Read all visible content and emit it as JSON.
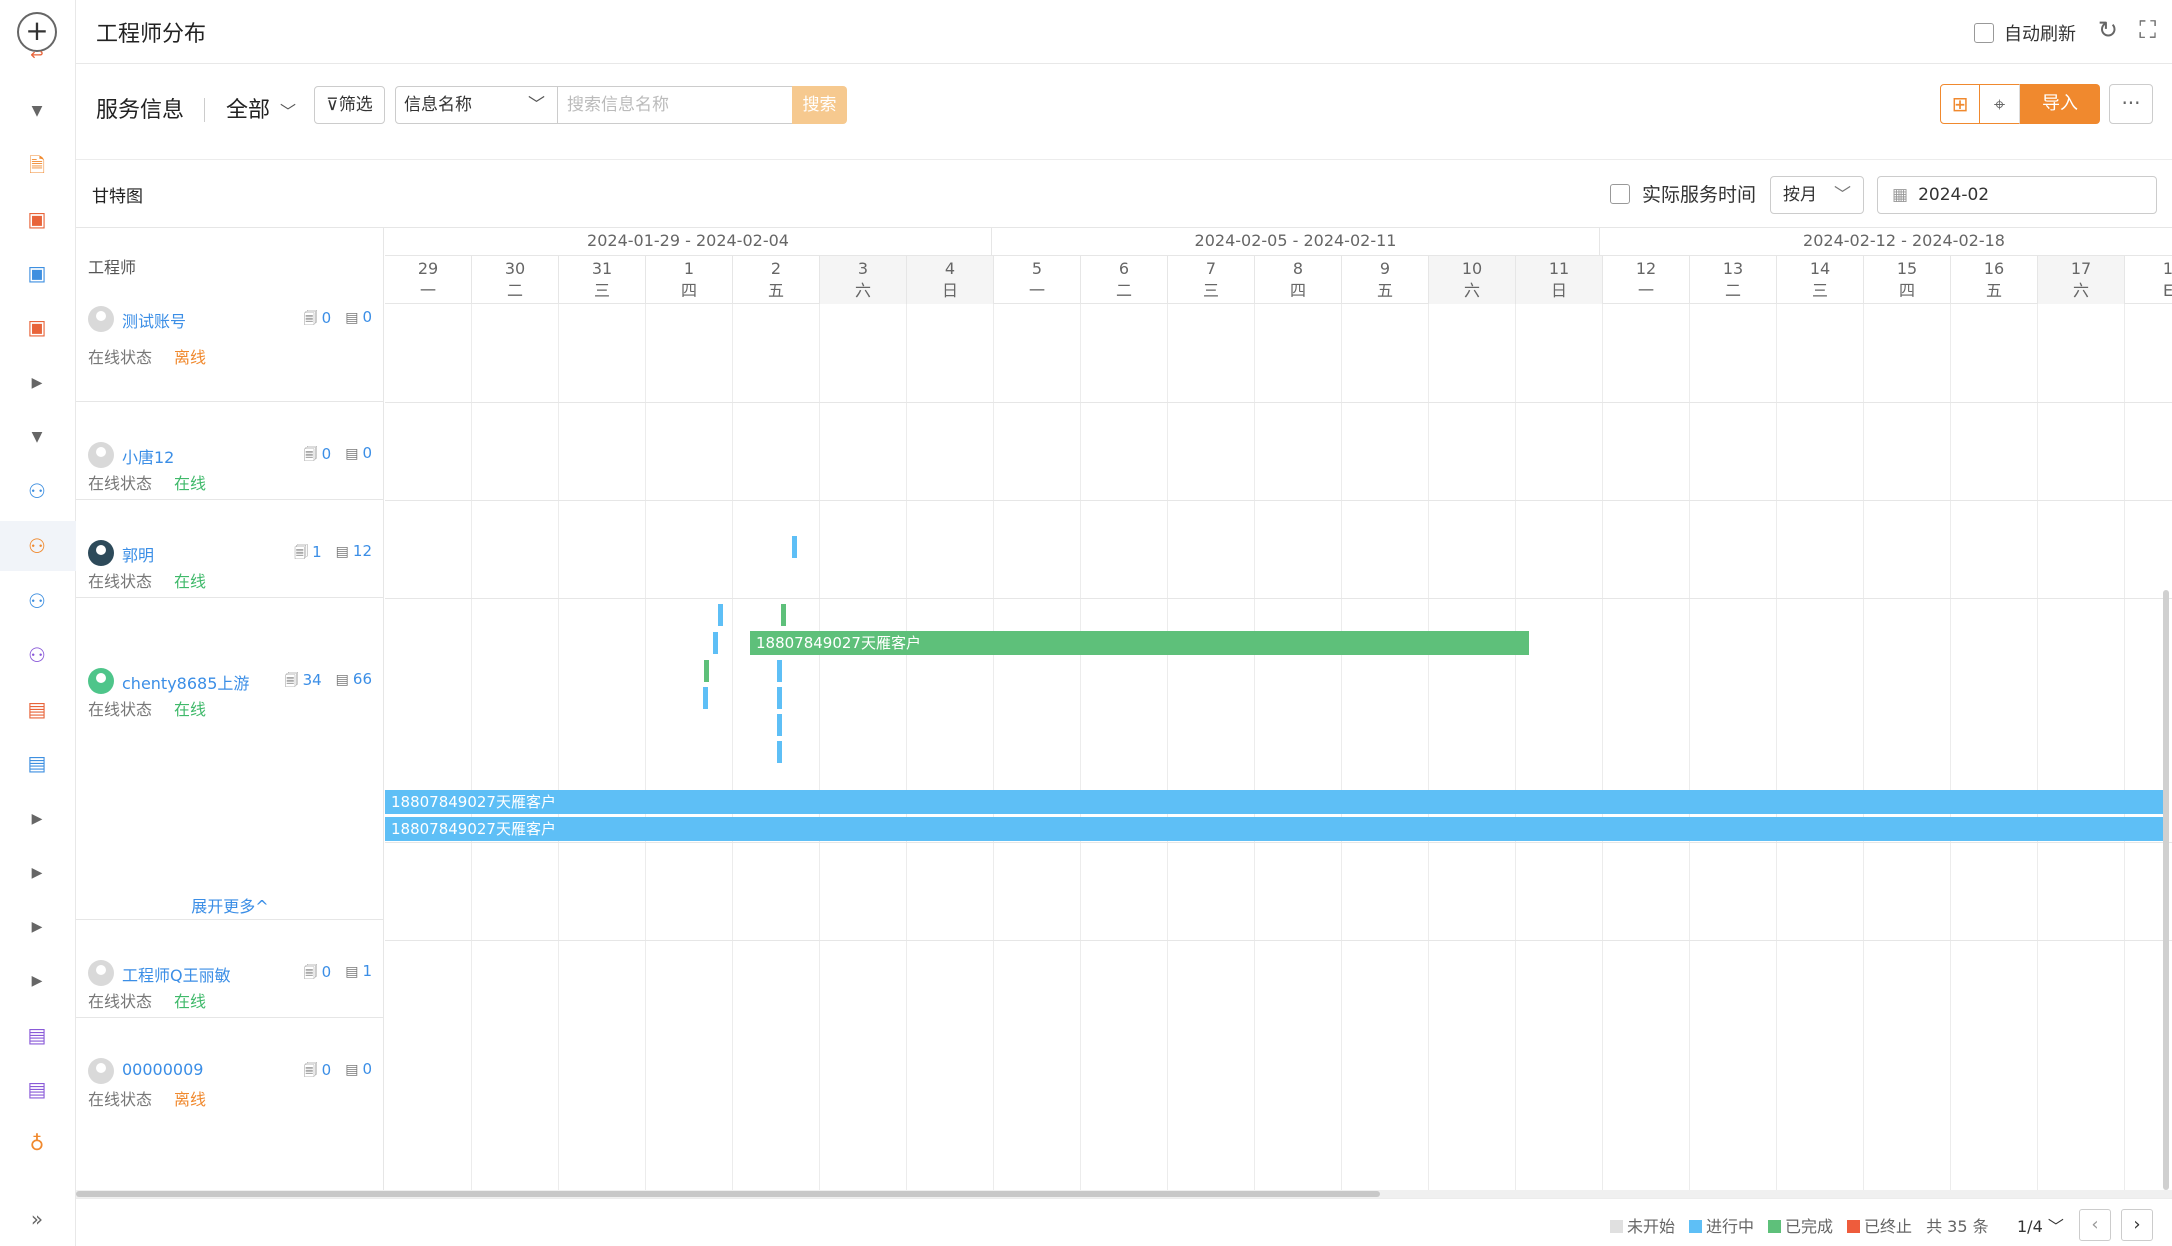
{
  "header": {
    "title": "工程师分布",
    "auto_refresh_label": "自动刷新"
  },
  "toolbar": {
    "label": "服务信息",
    "scope": "全部",
    "filter_label": "筛选",
    "field_select": "信息名称",
    "search_placeholder": "搜索信息名称",
    "search_button": "搜索",
    "import_button": "导入",
    "accent": "#f0892e"
  },
  "gantt": {
    "title": "甘特图",
    "actual_time_label": "实际服务时间",
    "mode": "按月",
    "month": "2024-02",
    "column_header": "工程师",
    "weeks": [
      "2024-01-29 - 2024-02-04",
      "2024-02-05 - 2024-02-11",
      "2024-02-12 - 2024-02-18"
    ],
    "days": [
      {
        "d": "29",
        "w": "一"
      },
      {
        "d": "30",
        "w": "二"
      },
      {
        "d": "31",
        "w": "三"
      },
      {
        "d": "1",
        "w": "四"
      },
      {
        "d": "2",
        "w": "五"
      },
      {
        "d": "3",
        "w": "六"
      },
      {
        "d": "4",
        "w": "日"
      },
      {
        "d": "5",
        "w": "一"
      },
      {
        "d": "6",
        "w": "二"
      },
      {
        "d": "7",
        "w": "三"
      },
      {
        "d": "8",
        "w": "四"
      },
      {
        "d": "9",
        "w": "五"
      },
      {
        "d": "10",
        "w": "六"
      },
      {
        "d": "11",
        "w": "日"
      },
      {
        "d": "12",
        "w": "一"
      },
      {
        "d": "13",
        "w": "二"
      },
      {
        "d": "14",
        "w": "三"
      },
      {
        "d": "15",
        "w": "四"
      },
      {
        "d": "16",
        "w": "五"
      },
      {
        "d": "17",
        "w": "六"
      },
      {
        "d": "1",
        "w": "E"
      }
    ],
    "bar_label": "18807849027天雁客户",
    "expand_more": "展开更多^"
  },
  "engineers": [
    {
      "name": "测试账号",
      "a": "0",
      "b": "0",
      "status_label": "在线状态",
      "status": "离线"
    },
    {
      "name": "小唐12",
      "a": "0",
      "b": "0",
      "status_label": "在线状态",
      "status": "在线"
    },
    {
      "name": "郭明",
      "a": "1",
      "b": "12",
      "status_label": "在线状态",
      "status": "在线"
    },
    {
      "name": "chenty8685上游",
      "a": "34",
      "b": "66",
      "status_label": "在线状态",
      "status": "在线"
    },
    {
      "name": "工程师Q王丽敏",
      "a": "0",
      "b": "1",
      "status_label": "在线状态",
      "status": "在线"
    },
    {
      "name": "00000009",
      "a": "0",
      "b": "0",
      "status_label": "在线状态",
      "status": "离线"
    }
  ],
  "footer": {
    "legend": [
      "未开始",
      "进行中",
      "已完成",
      "已终止"
    ],
    "legend_colors": [
      "#e0e0e0",
      "#5ebff6",
      "#5ec07a",
      "#ee5c3c"
    ],
    "total": "共 35 条",
    "page": "1/4"
  },
  "icons": [
    "plus-icon",
    "collapse-arrow-icon",
    "doc-icon",
    "clipboard-icon",
    "user-icon",
    "expand-icon"
  ]
}
